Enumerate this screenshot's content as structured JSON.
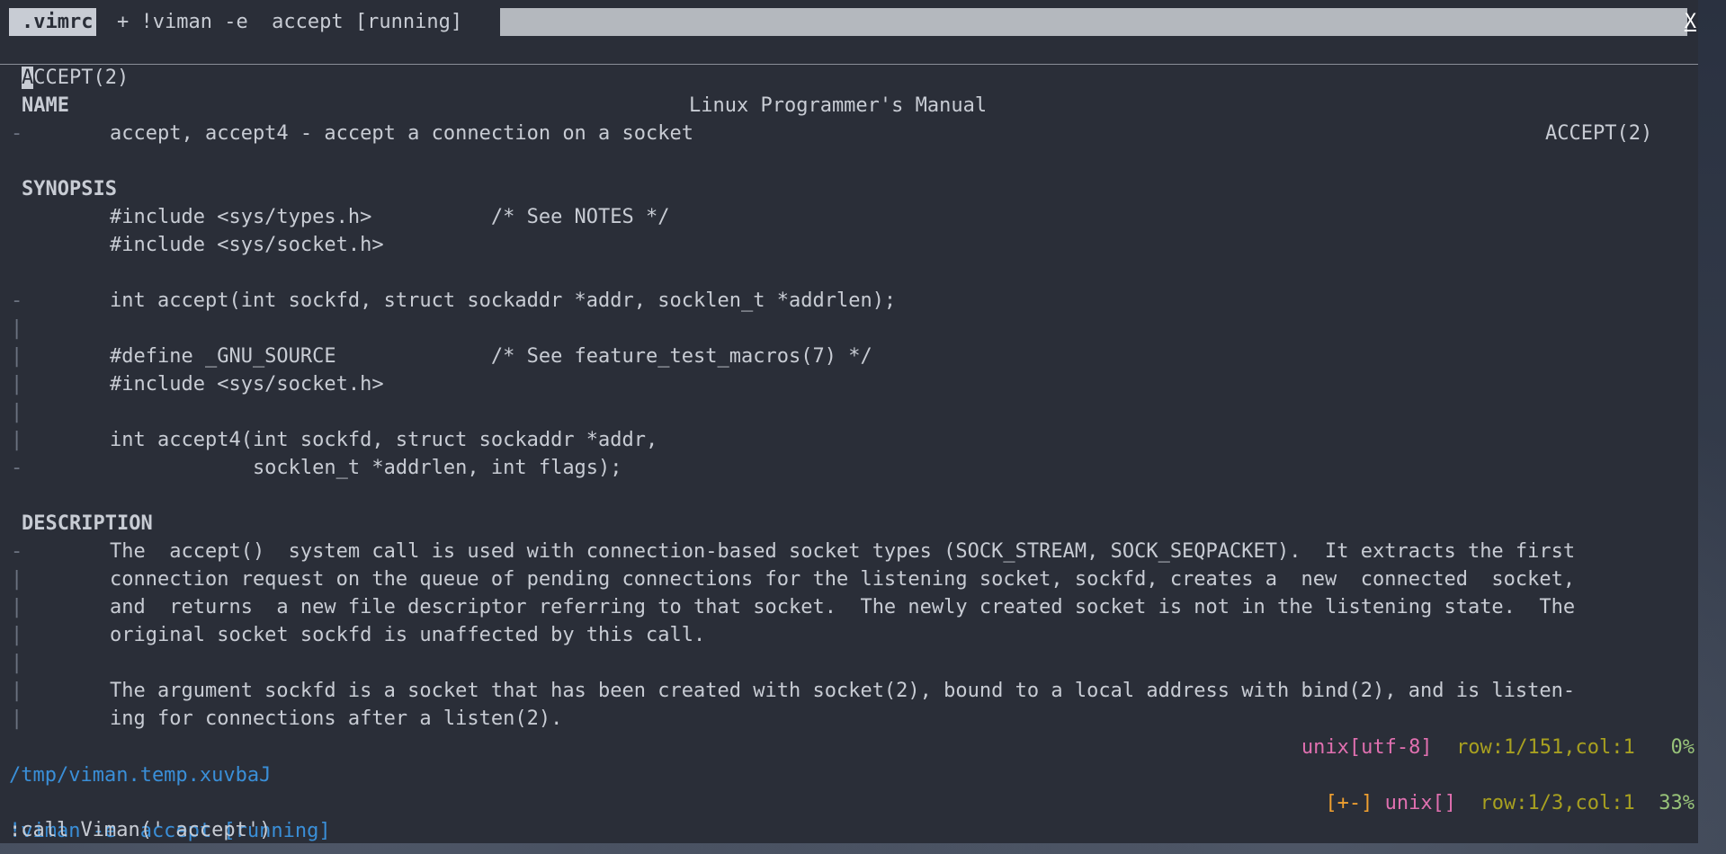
{
  "tabs": {
    "active": ".vimrc",
    "inactive": "+ !viman -e  accept [running]",
    "close": "X"
  },
  "man_header": {
    "left_cursor": "A",
    "left_rest": "CCEPT(2)",
    "center": "Linux Programmer's Manual",
    "right": "ACCEPT(2)"
  },
  "sections": {
    "name": "NAME",
    "synopsis": "SYNOPSIS",
    "description": "DESCRIPTION"
  },
  "lines": {
    "name_1": "accept, accept4 - accept a connection on a socket",
    "syn_1": "#include <sys/types.h>          /* See NOTES */",
    "syn_2": "#include <sys/socket.h>",
    "syn_3": "int accept(int sockfd, struct sockaddr *addr, socklen_t *addrlen);",
    "syn_4": "#define _GNU_SOURCE             /* See feature_test_macros(7) */",
    "syn_5": "#include <sys/socket.h>",
    "syn_6": "int accept4(int sockfd, struct sockaddr *addr,",
    "syn_7": "            socklen_t *addrlen, int flags);",
    "desc_1": "The  accept()  system call is used with connection-based socket types (SOCK_STREAM, SOCK_SEQPACKET).  It extracts the first",
    "desc_2": "connection request on the queue of pending connections for the listening socket, sockfd, creates a  new  connected  socket,",
    "desc_3": "and  returns  a new file descriptor referring to that socket.  The newly created socket is not in the listening state.  The",
    "desc_4": "original socket sockfd is unaffected by this call.",
    "desc_5": "The argument sockfd is a socket that has been created with socket(2), bound to a local address with bind(2), and is listen-",
    "desc_6": "ing for connections after a listen(2)."
  },
  "fold_markers": {
    "dash": "-",
    "bar": "|"
  },
  "status_top": {
    "file": "/tmp/viman.temp.xuvbaJ",
    "format": "unix[utf-8]",
    "position": "row:1/151,col:1",
    "percent": "0%"
  },
  "status_bottom": {
    "file": "!viman -e  accept [running]",
    "modified": "[+-]",
    "format": "unix[]",
    "position": "row:1/3,col:1",
    "percent": "33%"
  },
  "command_line": ":call Viman(' accept')",
  "colors": {
    "background": "#2a2e38",
    "text": "#c8ccd4",
    "status_blue": "#3a8fd8",
    "pink": "#e070b0",
    "olive": "#a8a020",
    "green": "#98c379",
    "orange": "#f0a030"
  }
}
